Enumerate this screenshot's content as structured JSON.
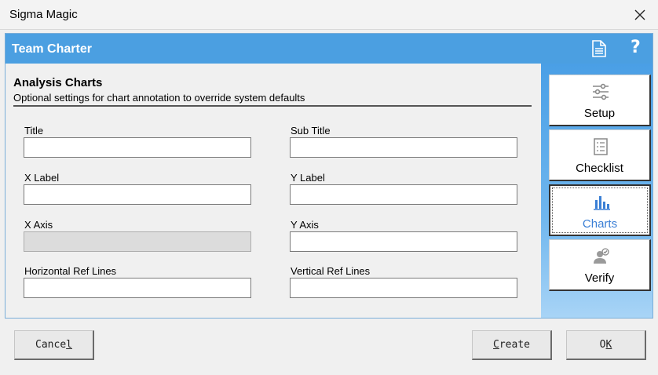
{
  "window": {
    "title": "Sigma Magic"
  },
  "header": {
    "title": "Team Charter"
  },
  "section": {
    "title": "Analysis Charts",
    "subtitle": "Optional settings for chart annotation to override system defaults"
  },
  "fields": {
    "title": {
      "label": "Title",
      "value": ""
    },
    "sub_title": {
      "label": "Sub Title",
      "value": ""
    },
    "x_label": {
      "label": "X Label",
      "value": ""
    },
    "y_label": {
      "label": "Y Label",
      "value": ""
    },
    "x_axis": {
      "label": "X Axis",
      "value": "",
      "disabled": true
    },
    "y_axis": {
      "label": "Y Axis",
      "value": ""
    },
    "h_ref": {
      "label": "Horizontal Ref Lines",
      "value": ""
    },
    "v_ref": {
      "label": "Vertical Ref Lines",
      "value": ""
    }
  },
  "nav": [
    {
      "label": "Setup",
      "icon": "sliders-icon"
    },
    {
      "label": "Checklist",
      "icon": "checklist-icon"
    },
    {
      "label": "Charts",
      "icon": "bar-chart-icon",
      "active": true
    },
    {
      "label": "Verify",
      "icon": "verify-user-icon"
    }
  ],
  "buttons": {
    "cancel": {
      "pre": "Cance",
      "accel": "l",
      "post": ""
    },
    "create": {
      "pre": "",
      "accel": "C",
      "post": "reate"
    },
    "ok": {
      "pre": "O",
      "accel": "K",
      "post": ""
    }
  },
  "colors": {
    "header": "#4b9fe1",
    "active_nav_text": "#3a7fd5"
  }
}
